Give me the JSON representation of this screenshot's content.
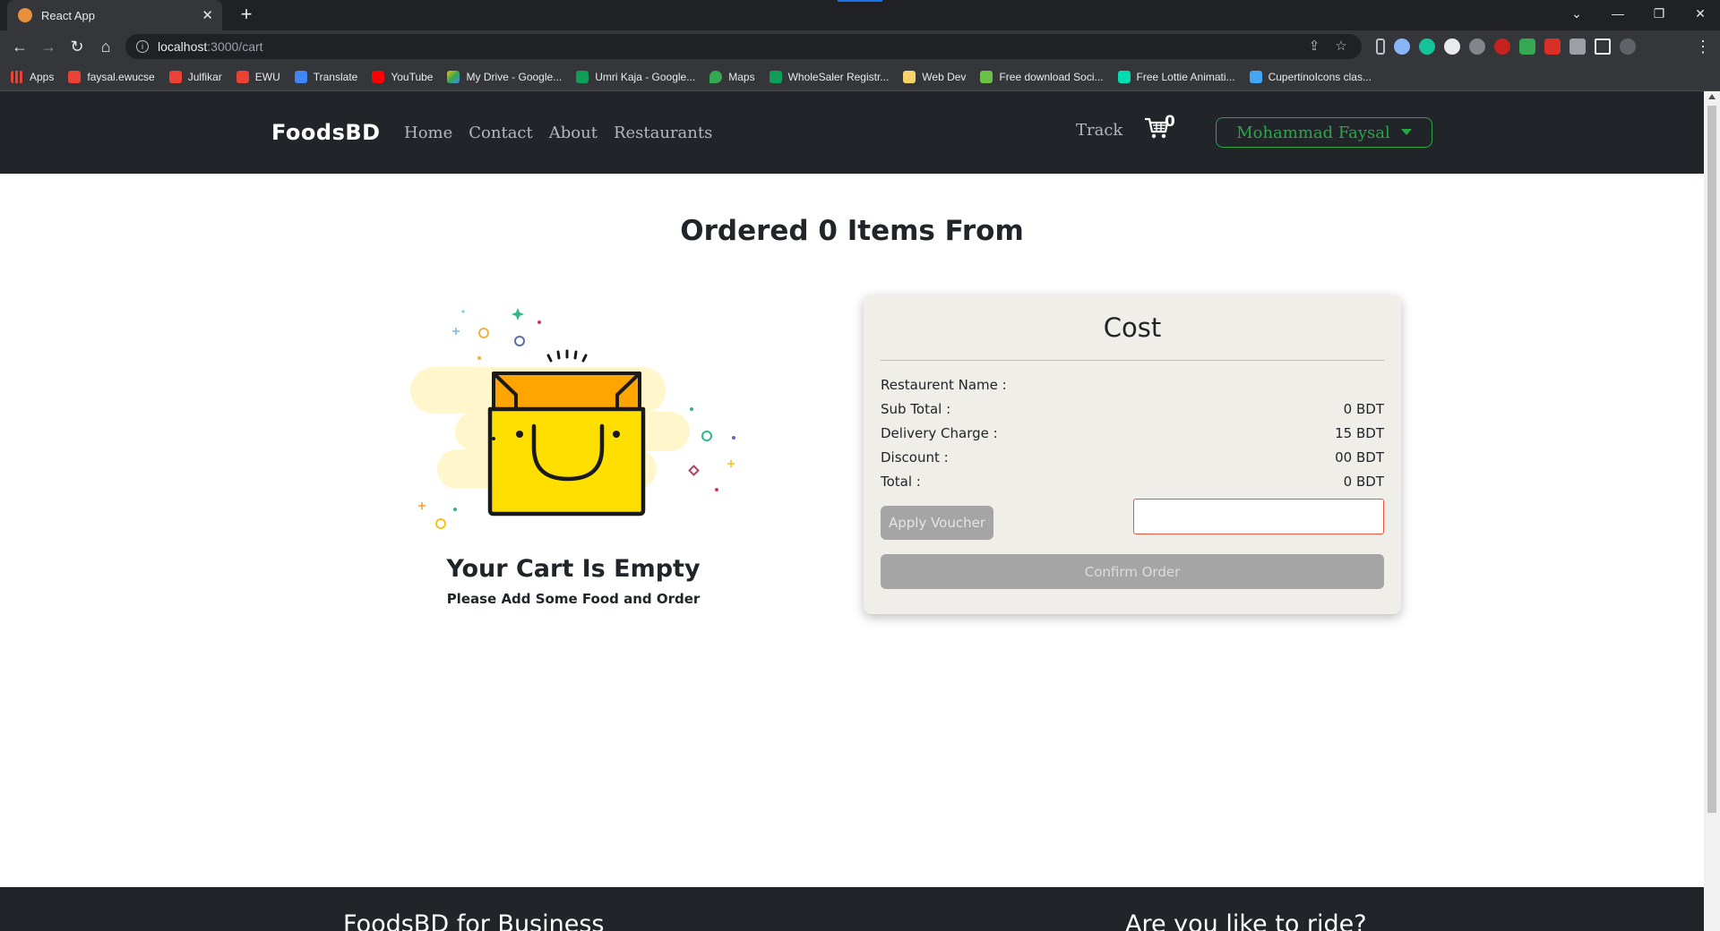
{
  "browser": {
    "tab_title": "React App",
    "tab_close": "✕",
    "new_tab": "+",
    "url_host": "localhost",
    "url_path": ":3000/cart",
    "bookmarks": [
      {
        "label": "Apps",
        "color": "#e8eaed"
      },
      {
        "label": "faysal.ewucse",
        "color": "#ea4335"
      },
      {
        "label": "Julfikar",
        "color": "#ea4335"
      },
      {
        "label": "EWU",
        "color": "#ea4335"
      },
      {
        "label": "Translate",
        "color": "#4285f4"
      },
      {
        "label": "YouTube",
        "color": "#ff0000"
      },
      {
        "label": "My Drive - Google...",
        "color": "#fbbc04"
      },
      {
        "label": "Umri Kaja - Google...",
        "color": "#0f9d58"
      },
      {
        "label": "Maps",
        "color": "#34a853"
      },
      {
        "label": "WholeSaler Registr...",
        "color": "#0f9d58"
      },
      {
        "label": "Web Dev",
        "color": "#f6d36a"
      },
      {
        "label": "Free download Soci...",
        "color": "#6cc04a"
      },
      {
        "label": "Free Lottie Animati...",
        "color": "#00ddb3"
      },
      {
        "label": "CupertinoIcons clas...",
        "color": "#42a5f5"
      }
    ]
  },
  "navbar": {
    "brand": "FoodsBD",
    "links": [
      "Home",
      "Contact",
      "About",
      "Restaurants"
    ],
    "track": "Track",
    "cart_count": "0",
    "user_name": "Mohammad Faysal"
  },
  "main": {
    "title": "Ordered 0 Items From",
    "empty_title": "Your Cart Is Empty",
    "empty_subtitle": "Please Add Some Food and Order"
  },
  "cost": {
    "title": "Cost",
    "rows": [
      {
        "label": "Restaurent Name :",
        "value": ""
      },
      {
        "label": "Sub Total :",
        "value": "0 BDT"
      },
      {
        "label": "Delivery Charge :",
        "value": "15 BDT"
      },
      {
        "label": "Discount :",
        "value": "00 BDT"
      },
      {
        "label": "Total :",
        "value": "0 BDT"
      }
    ],
    "apply_voucher": "Apply Voucher",
    "voucher_value": "",
    "confirm_order": "Confirm Order"
  },
  "footer": {
    "business_heading": "FoodsBD for Business",
    "ride_heading": "Are you like to ride?"
  },
  "colors": {
    "navbar_bg": "#212529",
    "accent_green": "#28a745",
    "card_bg": "#efeee8",
    "disabled_button": "#a5a5a5",
    "bag_yellow": "#ffd900",
    "bag_orange": "#ffa500"
  }
}
